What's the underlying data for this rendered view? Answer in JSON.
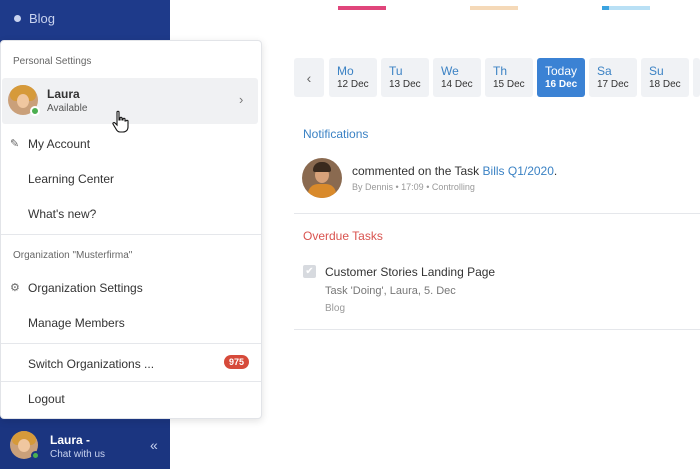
{
  "sidebar": {
    "blog_label": "Blog",
    "footer": {
      "name": "Laura",
      "caret": "-",
      "subtitle": "Chat with us",
      "collapse_icon": "«"
    }
  },
  "top_bars": [
    "#e0457b",
    "#f5d9b8",
    "#b9e0f5",
    "#3ba3e0"
  ],
  "calendar": {
    "prev_icon": "‹",
    "days": [
      {
        "name": "Mo",
        "date": "12 Dec",
        "active": false
      },
      {
        "name": "Tu",
        "date": "13 Dec",
        "active": false
      },
      {
        "name": "We",
        "date": "14 Dec",
        "active": false
      },
      {
        "name": "Th",
        "date": "15 Dec",
        "active": false
      },
      {
        "name": "Today",
        "date": "16 Dec",
        "active": true
      },
      {
        "name": "Sa",
        "date": "17 Dec",
        "active": false
      },
      {
        "name": "Su",
        "date": "18 Dec",
        "active": false
      }
    ]
  },
  "notifications": {
    "title": "Notifications",
    "item": {
      "text_prefix": "commented on the Task ",
      "link": "Bills Q1/2020",
      "text_suffix": ".",
      "meta": "By Dennis • 17:09 • Controlling"
    }
  },
  "overdue": {
    "title": "Overdue Tasks",
    "task": {
      "check_icon": "✔",
      "title": "Customer Stories Landing Page",
      "subtitle": "Task 'Doing', Laura, 5. Dec",
      "project": "Blog"
    }
  },
  "menu": {
    "personal_label": "Personal Settings",
    "user": {
      "name": "Laura",
      "status": "Available",
      "chevron": "›"
    },
    "my_account": "My Account",
    "learning_center": "Learning Center",
    "whats_new": "What's new?",
    "org_label": "Organization \"Musterfirma\"",
    "org_settings": "Organization Settings",
    "manage_members": "Manage Members",
    "switch_orgs": "Switch Organizations ...",
    "switch_badge": "975",
    "logout": "Logout",
    "pencil_icon": "✎",
    "gear_icon": "⚙"
  },
  "colors": {
    "sidebar_bg": "#1e3a8a",
    "accent_blue": "#3b82d4",
    "overdue_red": "#d9534f",
    "badge_red": "#d64a3a",
    "status_green": "#4caf50"
  }
}
